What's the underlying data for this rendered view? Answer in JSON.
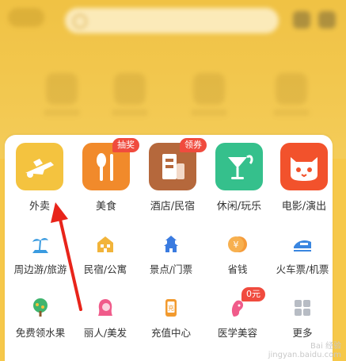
{
  "top_grid": [
    {
      "label": "外卖",
      "icon": "scooter-icon",
      "color": "#f4c33f"
    },
    {
      "label": "美食",
      "icon": "fork-knife-icon",
      "color": "#f18a2b",
      "badge": "抽奖"
    },
    {
      "label": "酒店/民宿",
      "icon": "hotel-building-icon",
      "color": "#b5683c",
      "badge": "领券"
    },
    {
      "label": "休闲/玩乐",
      "icon": "cocktail-icon",
      "color": "#35c08c"
    },
    {
      "label": "电影/演出",
      "icon": "cat-face-icon",
      "color": "#f2522c"
    }
  ],
  "rows": [
    [
      {
        "label": "周边游/旅游",
        "icon": "palm-tree-icon"
      },
      {
        "label": "民宿/公寓",
        "icon": "house-icon"
      },
      {
        "label": "景点/门票",
        "icon": "pagoda-icon"
      },
      {
        "label": "省钱",
        "icon": "yuan-coin-icon"
      },
      {
        "label": "火车票/机票",
        "icon": "train-icon"
      }
    ],
    [
      {
        "label": "免费领水果",
        "icon": "fruit-tree-icon"
      },
      {
        "label": "丽人/美发",
        "icon": "hair-woman-icon"
      },
      {
        "label": "充值中心",
        "icon": "phone-charge-icon"
      },
      {
        "label": "医学美容",
        "icon": "face-beauty-icon",
        "badge": "0元"
      },
      {
        "label": "更多",
        "icon": "grid-more-icon"
      }
    ]
  ],
  "watermark": {
    "line1": "Bai 经验",
    "line2": "jingyan.baidu.com"
  }
}
